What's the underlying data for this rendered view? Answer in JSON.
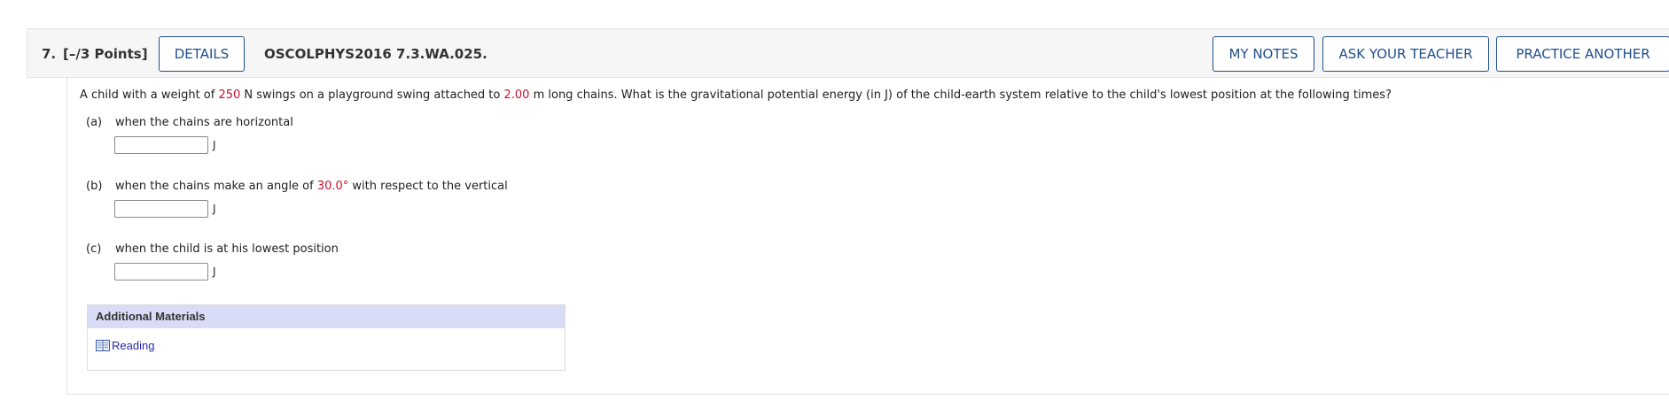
{
  "question": {
    "number": "7.",
    "points": "[–/3 Points]",
    "details_label": "DETAILS",
    "code": "OSCOLPHYS2016 7.3.WA.025.",
    "my_notes_label": "MY NOTES",
    "ask_teacher_label": "ASK YOUR TEACHER",
    "practice_another_label": "PRACTICE ANOTHER"
  },
  "stem": {
    "part1": "A child with a weight of ",
    "weight_value": "250",
    "part2": " N swings on a playground swing attached to ",
    "length_value": "2.00",
    "part3": " m long chains. What is the gravitational potential energy (in J) of the child-earth system relative to the child's lowest position at the following times?"
  },
  "parts": [
    {
      "letter": "(a)",
      "text": "when the chains are horizontal",
      "unit": "J",
      "value": ""
    },
    {
      "letter": "(b)",
      "text_before": "when the chains make an angle of ",
      "angle_value": "30.0°",
      "text_after": " with respect to the vertical",
      "unit": "J",
      "value": ""
    },
    {
      "letter": "(c)",
      "text": "when the child is at his lowest position",
      "unit": "J",
      "value": ""
    }
  ],
  "materials": {
    "heading": "Additional Materials",
    "reading_label": "Reading"
  },
  "colors": {
    "button_border": "#1f4f8a",
    "given_value": "#c8102e",
    "materials_header": "#d9dcf6",
    "link": "#2a2aa8"
  },
  "icons": {
    "reading": "book-icon"
  }
}
